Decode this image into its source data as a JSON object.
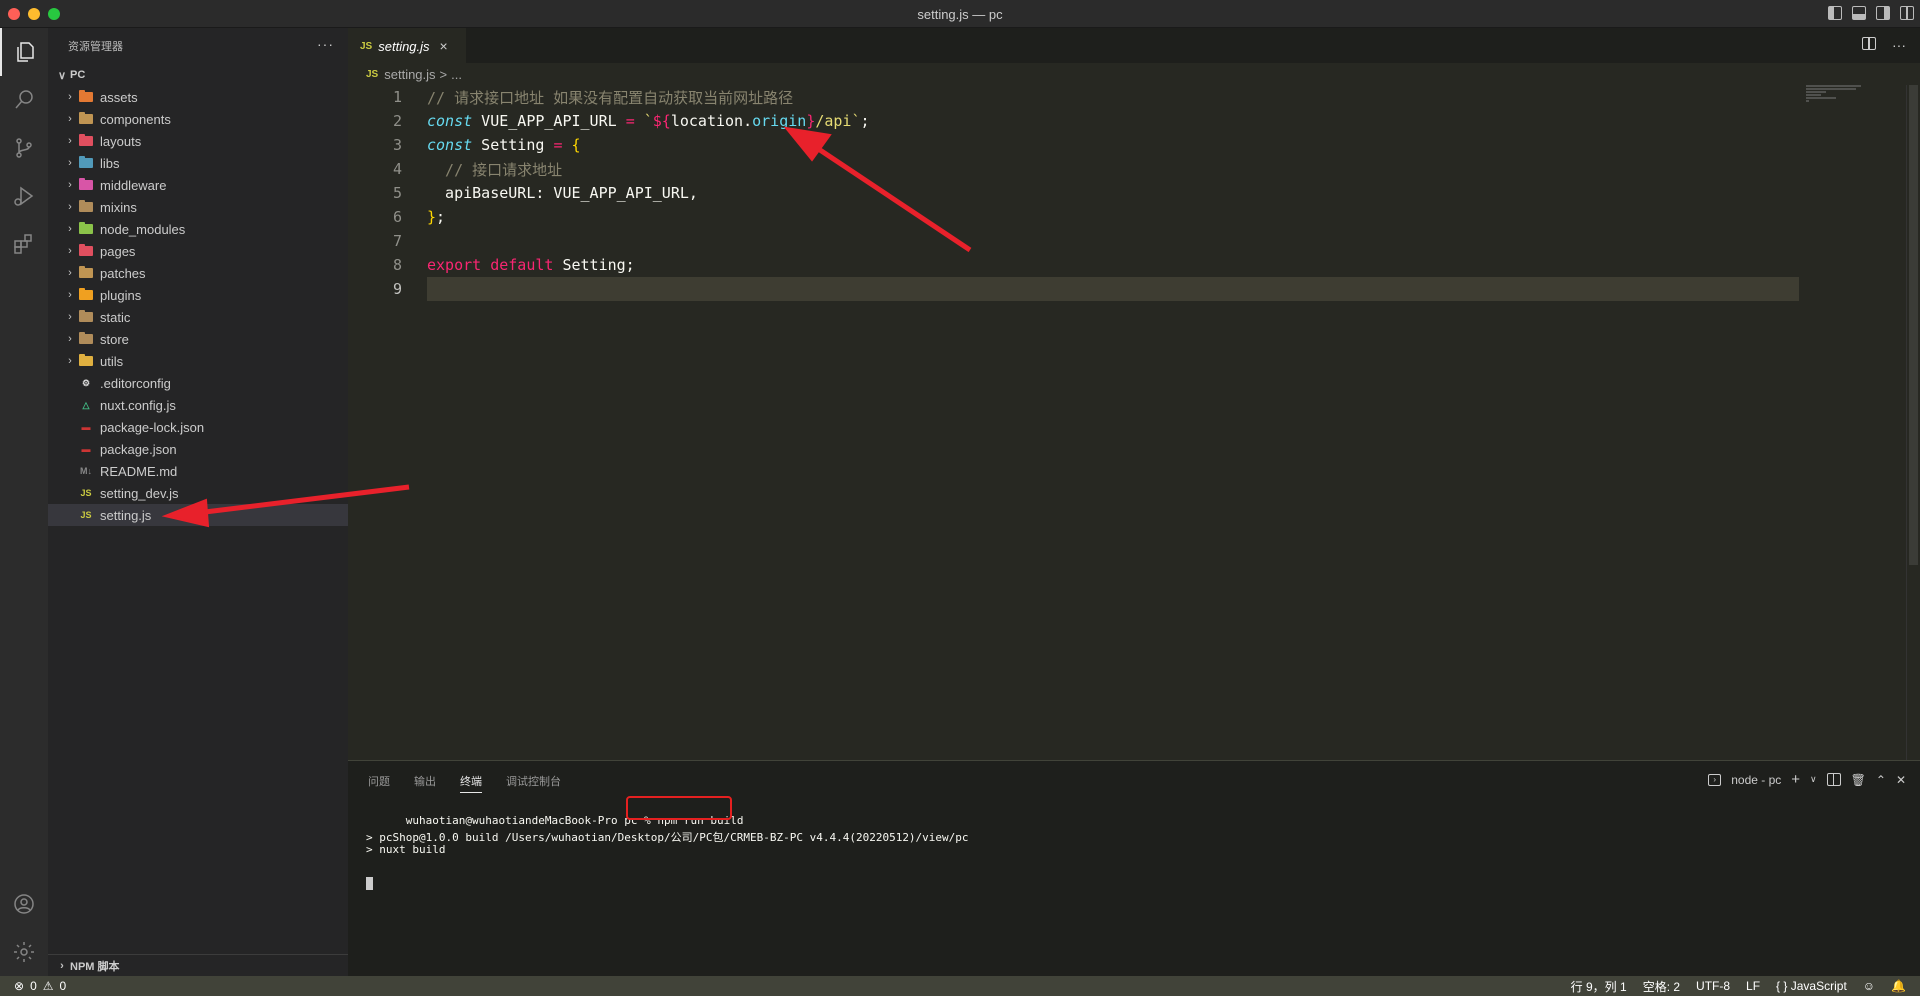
{
  "window": {
    "title": "setting.js — pc"
  },
  "sidebar": {
    "header": "资源管理器",
    "root": "PC",
    "folders": [
      {
        "label": "assets",
        "color": "#e37933"
      },
      {
        "label": "components",
        "color": "#c09553"
      },
      {
        "label": "layouts",
        "color": "#e04f5f"
      },
      {
        "label": "libs",
        "color": "#519aba"
      },
      {
        "label": "middleware",
        "color": "#d855a7"
      },
      {
        "label": "mixins",
        "color": "#b08c5a"
      },
      {
        "label": "node_modules",
        "color": "#8bc34a"
      },
      {
        "label": "pages",
        "color": "#e04f5f"
      },
      {
        "label": "patches",
        "color": "#c09553"
      },
      {
        "label": "plugins",
        "color": "#f0a020"
      },
      {
        "label": "static",
        "color": "#b08c5a"
      },
      {
        "label": "store",
        "color": "#b08c5a"
      },
      {
        "label": "utils",
        "color": "#e0b040"
      }
    ],
    "files": [
      {
        "label": ".editorconfig",
        "icon": "gear-icon",
        "color": "#dddddd"
      },
      {
        "label": "nuxt.config.js",
        "icon": "nuxt-icon",
        "color": "#41b883"
      },
      {
        "label": "package-lock.json",
        "icon": "npm-icon",
        "color": "#cc3534"
      },
      {
        "label": "package.json",
        "icon": "npm-icon",
        "color": "#cc3534"
      },
      {
        "label": "README.md",
        "icon": "markdown-icon",
        "color": "#888888"
      },
      {
        "label": "setting_dev.js",
        "icon": "js-icon",
        "color": "#cbcb41"
      },
      {
        "label": "setting.js",
        "icon": "js-icon",
        "color": "#cbcb41"
      }
    ],
    "npm_section": "NPM 脚本"
  },
  "editor": {
    "tab": {
      "label": "setting.js",
      "badge": "JS",
      "close": "×"
    },
    "breadcrumb": {
      "badge": "JS",
      "file": "setting.js",
      "sep": ">",
      "rest": "..."
    },
    "line_numbers": [
      "1",
      "2",
      "3",
      "4",
      "5",
      "6",
      "7",
      "8",
      "9"
    ],
    "code": {
      "l1_comment": "// 请求接口地址 如果没有配置自动获取当前网址路径",
      "l2_kw": "const",
      "l2_name": " VUE_APP_API_URL ",
      "l2_eq": "=",
      "l2_tick1": " `",
      "l2_interp_open": "${",
      "l2_obj": "location.",
      "l2_prop": "origin",
      "l2_interp_close": "}",
      "l2_tail": "/api`",
      "l2_semi": ";",
      "l3_kw": "const",
      "l3_name": " Setting ",
      "l3_eq": "=",
      "l3_brace": " {",
      "l4_comment": "  // 接口请求地址",
      "l5_text": "  apiBaseURL: VUE_APP_API_URL,",
      "l6_brace": "}",
      "l6_semi": ";",
      "l8_kw1": "export",
      "l8_kw2": " default",
      "l8_rest": " Setting;"
    }
  },
  "panel": {
    "tabs": [
      "问题",
      "输出",
      "终端",
      "调试控制台"
    ],
    "active_tab": "终端",
    "terminal_name": "node - pc",
    "terminal": {
      "prompt": "wuhaotian@wuhaotiandeMacBook-Pro pc % ",
      "command": "npm run build",
      "out1": "> pcShop@1.0.0 build /Users/wuhaotian/Desktop/公司/PC包/CRMEB-BZ-PC v4.4.4(20220512)/view/pc",
      "out2": "> nuxt build"
    }
  },
  "statusbar": {
    "errors": "0",
    "warnings": "0",
    "position": "行 9，列 1",
    "spaces": "空格: 2",
    "encoding": "UTF-8",
    "eol": "LF",
    "language": "JavaScript"
  }
}
